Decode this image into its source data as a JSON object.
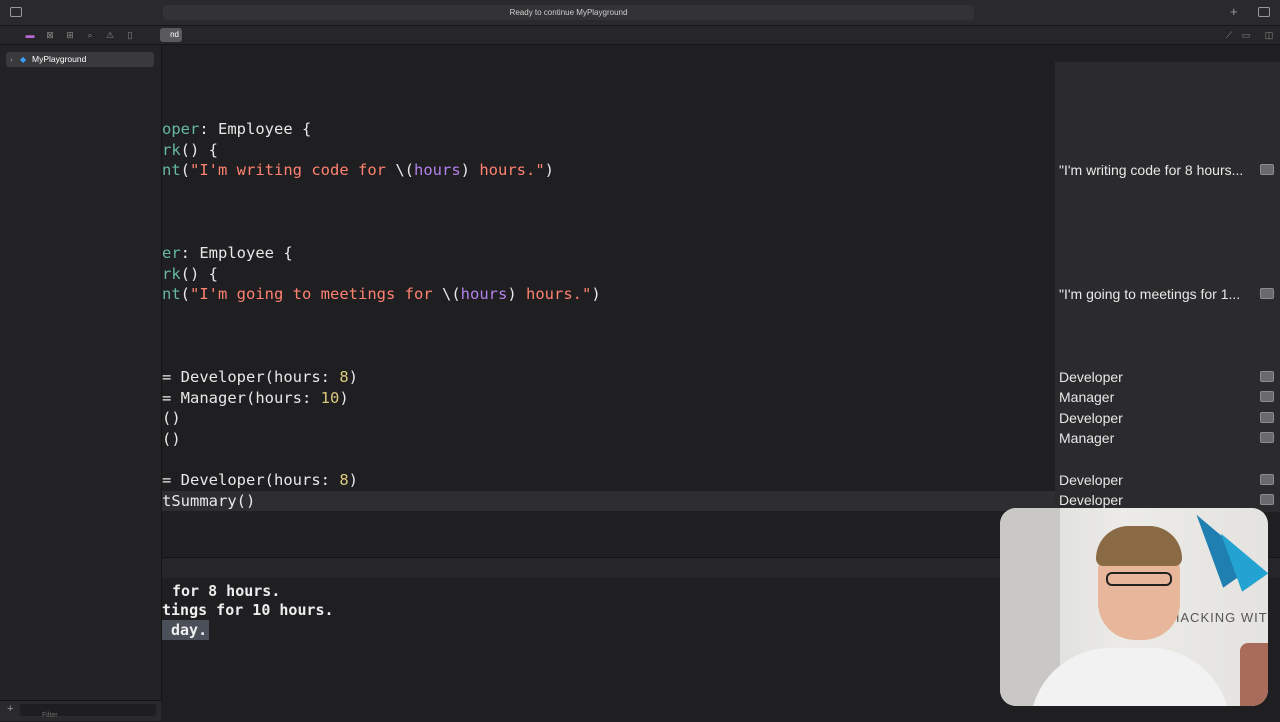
{
  "toolbar": {
    "status": "Ready to continue MyPlayground",
    "add_icon": "plus-icon",
    "sidebar_toggle_icon": "sidebar-left-icon",
    "inspector_toggle_icon": "sidebar-right-icon"
  },
  "tabbar": {
    "active_tab": "nd"
  },
  "navigator": {
    "items": [
      {
        "label": "MyPlayground",
        "icon": "swift-icon"
      }
    ],
    "filter_placeholder": "Filter"
  },
  "code": {
    "lines": [
      {
        "text": "oper: Employee {"
      },
      {
        "text": "rk() {"
      },
      {
        "text": "nt(\"I'm writing code for \\(hours) hours.\")"
      },
      {
        "text": "er: Employee {"
      },
      {
        "text": "rk() {"
      },
      {
        "text": "nt(\"I'm going to meetings for \\(hours) hours.\")"
      },
      {
        "text": "= Developer(hours: 8)"
      },
      {
        "text": "= Manager(hours: 10)"
      },
      {
        "text": "()"
      },
      {
        "text": "()"
      },
      {
        "text": "= Developer(hours: 8)"
      },
      {
        "text": "tSummary()"
      }
    ]
  },
  "results": [
    "\"I'm writing code for 8 hours...",
    "\"I'm going to meetings for 1...",
    "Developer",
    "Manager",
    "Developer",
    "Manager",
    "Developer",
    "Developer"
  ],
  "console": {
    "lines": [
      "for 8 hours.",
      "tings for 10 hours.",
      "day."
    ]
  },
  "webcam": {
    "brand_text": "HACKING WIT"
  }
}
